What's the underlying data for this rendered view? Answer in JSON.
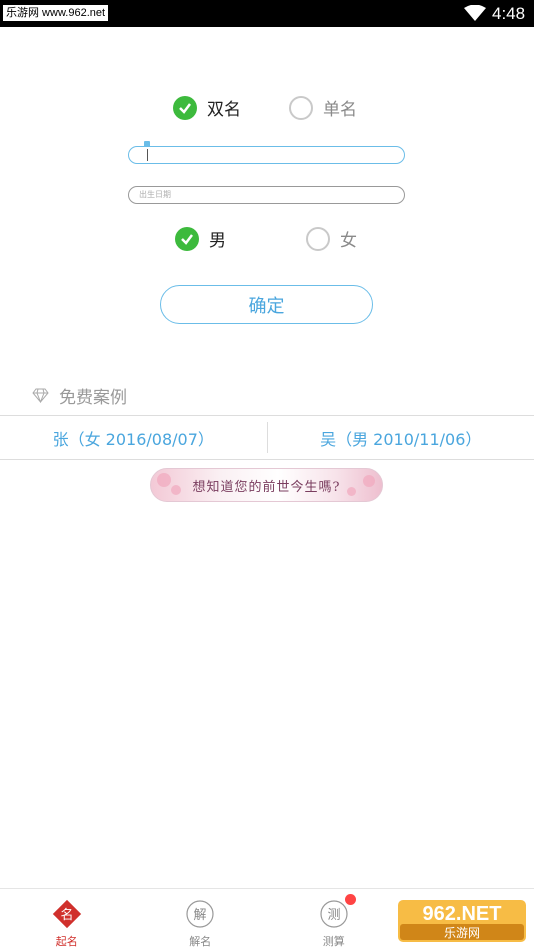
{
  "status_bar": {
    "watermark": "乐游网 www.962.net",
    "time": "4:48"
  },
  "name_type": {
    "options": [
      {
        "label": "双名",
        "checked": true
      },
      {
        "label": "单名",
        "checked": false
      }
    ]
  },
  "form": {
    "surname_value": "",
    "birthdate_placeholder": "出生日期"
  },
  "gender": {
    "options": [
      {
        "label": "男",
        "checked": true
      },
      {
        "label": "女",
        "checked": false
      }
    ]
  },
  "confirm_label": "确定",
  "free_cases": {
    "title": "免费案例",
    "items": [
      "张（女 2016/08/07）",
      "吴（男 2010/11/06）"
    ]
  },
  "banner_text": "想知道您的前世今生嗎?",
  "tabs": [
    {
      "label": "起名",
      "icon_char": "名",
      "active": true
    },
    {
      "label": "解名",
      "icon_char": "解",
      "active": false
    },
    {
      "label": "测算",
      "icon_char": "测",
      "active": false,
      "badge": true
    },
    {
      "label": "",
      "icon_char": "",
      "active": false
    }
  ],
  "watermark_bottom": {
    "brand": "962.NET",
    "sub": "乐游网"
  },
  "colors": {
    "accent": "#4aa6de",
    "check": "#3dba3d",
    "tab_active": "#d0302c"
  }
}
